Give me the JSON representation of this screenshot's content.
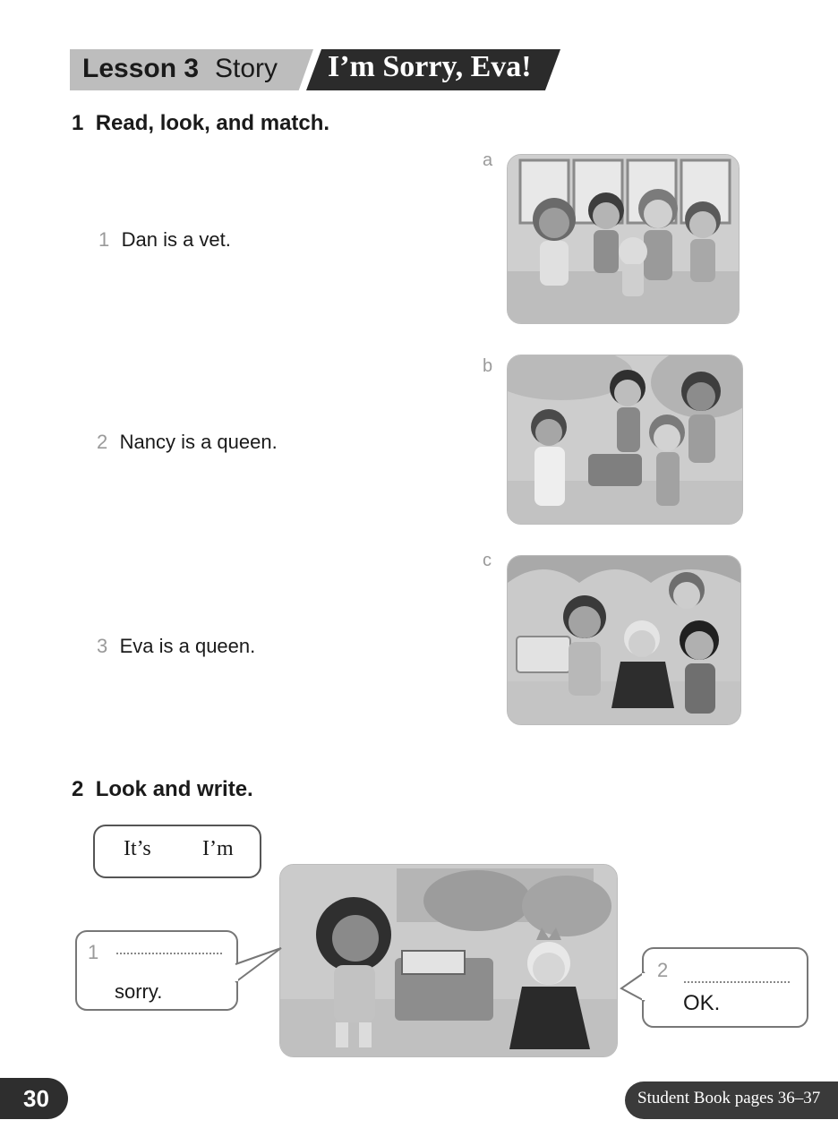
{
  "header": {
    "lesson": "Lesson 3",
    "story": "Story",
    "title": "I’m Sorry, Eva!"
  },
  "activity1": {
    "number": "1",
    "instruction": "Read, look, and match.",
    "sentences": [
      {
        "num": "1",
        "text": "Dan is a vet."
      },
      {
        "num": "2",
        "text": "Nancy is a queen."
      },
      {
        "num": "3",
        "text": "Eva is a queen."
      }
    ],
    "picture_letters": [
      "a",
      "b",
      "c"
    ]
  },
  "activity2": {
    "number": "2",
    "instruction": "Look and write.",
    "word_bank": [
      "It’s",
      "I’m"
    ],
    "bubbles": [
      {
        "num": "1",
        "text": "sorry."
      },
      {
        "num": "2",
        "text": "OK."
      }
    ]
  },
  "footer": {
    "page_number": "30",
    "reference": "Student Book pages 36–37"
  }
}
